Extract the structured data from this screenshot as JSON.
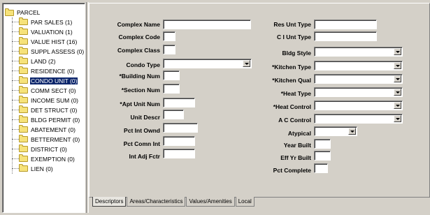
{
  "tree": {
    "root_label": "PARCEL",
    "items": [
      {
        "label": "PAR SALES (1)"
      },
      {
        "label": "VALUATION (1)"
      },
      {
        "label": "VALUE HIST (16)"
      },
      {
        "label": "SUPPL ASSESS (0)"
      },
      {
        "label": "LAND (2)"
      },
      {
        "label": "RESIDENCE (0)"
      },
      {
        "label": "CONDO UNIT (0)"
      },
      {
        "label": "COMM SECT (0)"
      },
      {
        "label": "INCOME SUM (0)"
      },
      {
        "label": "DET STRUCT (0)"
      },
      {
        "label": "BLDG PERMIT (0)"
      },
      {
        "label": "ABATEMENT (0)"
      },
      {
        "label": "BETTERMENT (0)"
      },
      {
        "label": "DISTRICT (0)"
      },
      {
        "label": "EXEMPTION (0)"
      },
      {
        "label": "LIEN (0)"
      }
    ],
    "selected_label": "CONDO UNIT (0)"
  },
  "form": {
    "left": {
      "complex_name": {
        "label": "Complex Name",
        "value": ""
      },
      "complex_code": {
        "label": "Complex Code",
        "value": ""
      },
      "complex_class": {
        "label": "Complex Class",
        "value": ""
      },
      "condo_type": {
        "label": "Condo Type",
        "value": ""
      },
      "building_num": {
        "label": "*Building Num",
        "value": ""
      },
      "section_num": {
        "label": "*Section Num",
        "value": ""
      },
      "apt_unit_num": {
        "label": "*Apt Unit Num",
        "value": ""
      },
      "unit_descr": {
        "label": "Unit Descr",
        "value": ""
      },
      "pct_int_ownd": {
        "label": "Pct Int Ownd",
        "value": ""
      },
      "pct_comn_int": {
        "label": "Pct Comn Int",
        "value": ""
      },
      "int_adj_fctr": {
        "label": "Int Adj Fctr",
        "value": ""
      }
    },
    "right": {
      "res_unt_type": {
        "label": "Res Unt Type",
        "value": ""
      },
      "ci_unt_type": {
        "label": "C I Unt Type",
        "value": ""
      },
      "bldg_style": {
        "label": "Bldg Style",
        "value": ""
      },
      "kitchen_type": {
        "label": "*Kitchen Type",
        "value": ""
      },
      "kitchen_qual": {
        "label": "*Kitchen Qual",
        "value": ""
      },
      "heat_type": {
        "label": "*Heat Type",
        "value": ""
      },
      "heat_control": {
        "label": "*Heat Control",
        "value": ""
      },
      "ac_control": {
        "label": "A C Control",
        "value": ""
      },
      "atypical": {
        "label": "Atypical",
        "value": ""
      },
      "year_built": {
        "label": "Year Built",
        "value": ""
      },
      "eff_yr_built": {
        "label": "Eff Yr Built",
        "value": ""
      },
      "pct_complete": {
        "label": "Pct Complete",
        "value": ""
      }
    }
  },
  "tabs": [
    {
      "label": "Descriptors"
    },
    {
      "label": "Areas/Characteristics"
    },
    {
      "label": "Values/Amenities"
    },
    {
      "label": "Local"
    }
  ],
  "active_tab": "Descriptors"
}
